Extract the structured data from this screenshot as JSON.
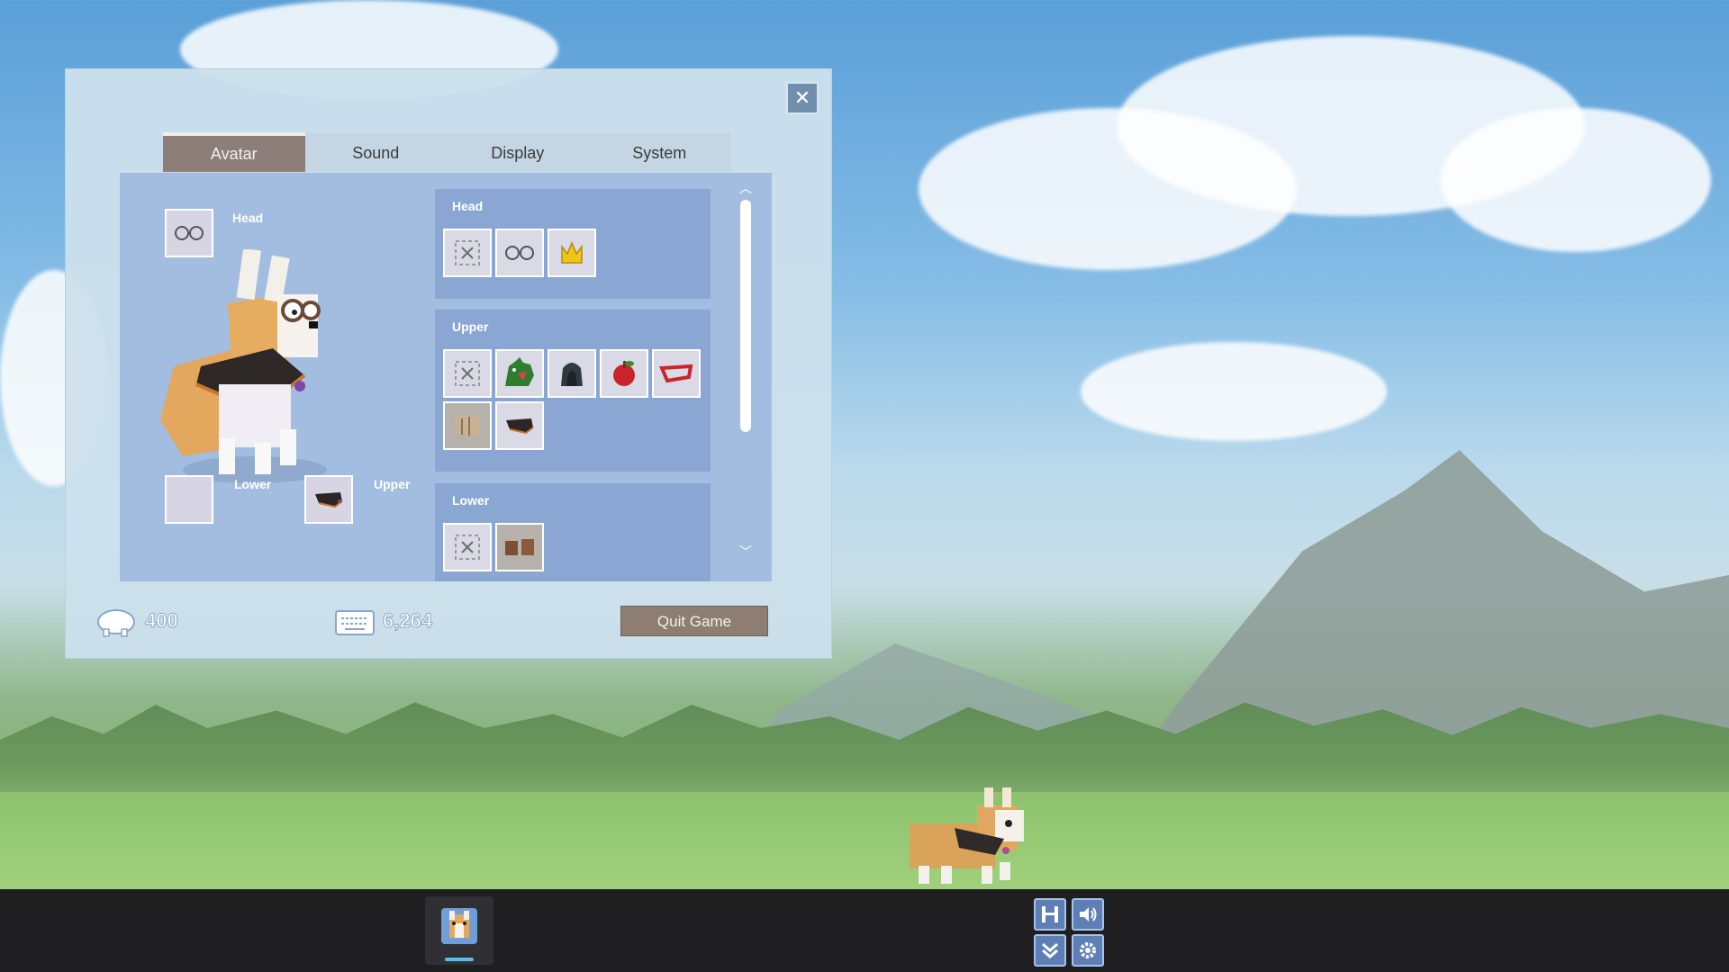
{
  "panel": {
    "close_symbol": "✕",
    "tabs": [
      {
        "label": "Avatar",
        "active": true
      },
      {
        "label": "Sound",
        "active": false
      },
      {
        "label": "Display",
        "active": false
      },
      {
        "label": "System",
        "active": false
      }
    ],
    "equipped": {
      "head_label": "Head",
      "lower_label": "Lower",
      "upper_label": "Upper",
      "head_item": "glasses-icon",
      "lower_item": "empty",
      "upper_item": "black-scarf-icon"
    },
    "sections": [
      {
        "title": "Head",
        "items": [
          "none-icon",
          "glasses-icon",
          "crown-icon"
        ]
      },
      {
        "title": "Upper",
        "items": [
          "none-icon",
          "dragon-hood-icon",
          "dark-hood-icon",
          "red-apple-icon",
          "red-tray-icon",
          "wooden-armor-icon",
          "black-scarf-icon"
        ]
      },
      {
        "title": "Lower",
        "items": [
          "none-icon",
          "brown-boots-icon"
        ]
      }
    ],
    "stats": {
      "coins": "400",
      "keys": "6,264"
    },
    "quit_label": "Quit Game"
  },
  "taskbar": {
    "app_icon": "corgi-avatar-icon",
    "quick_buttons": [
      "save-icon",
      "sound-icon",
      "minimize-icon",
      "settings-icon"
    ]
  },
  "colors": {
    "panel_bg": "#cce0ec",
    "tab_active": "#8e7e7a",
    "content_bg": "#a2bde0",
    "section_bg": "#8aa6d3",
    "quit_button": "#8e7e72",
    "taskbar": "#1f1f21",
    "taskbar_indicator": "#55bde8"
  }
}
